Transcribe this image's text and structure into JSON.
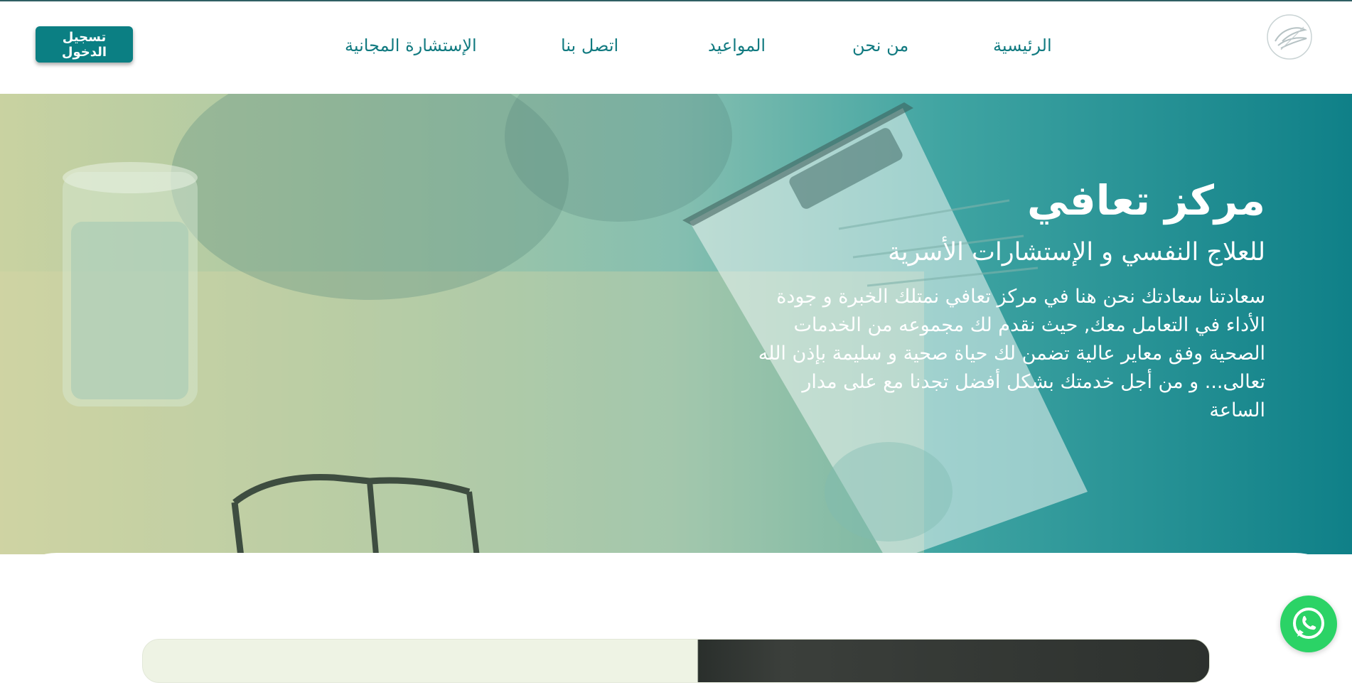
{
  "header": {
    "logo_icon": "feather-logo-icon",
    "nav": {
      "home": "الرئيسية",
      "about": "من نحن",
      "appointments": "المواعيد",
      "contact": "اتصل بنا",
      "free_consultation": "الإستشارة المجانية"
    },
    "login_label": "تسجيل الدخول"
  },
  "hero": {
    "title": "مركز تعافي",
    "subtitle": "للعلاج النفسي و الإستشارات الأسرية",
    "description": "سعادتنا سعادتك نحن هنا في مركز تعافي نمتلك الخبرة و جودة الأداء في التعامل معك, حيث نقدم لك مجموعه من الخدمات الصحية وفق معاير عالية تضمن لك حياة صحية و سليمة بإذن الله تعالى... و من أجل خدمتك بشكل أفضل تجدنا مع على مدار الساعة"
  },
  "floating": {
    "whatsapp_icon": "whatsapp-icon"
  },
  "colors": {
    "accent": "#0b7f83",
    "nav_text": "#117a80",
    "whatsapp": "#2bd366"
  }
}
